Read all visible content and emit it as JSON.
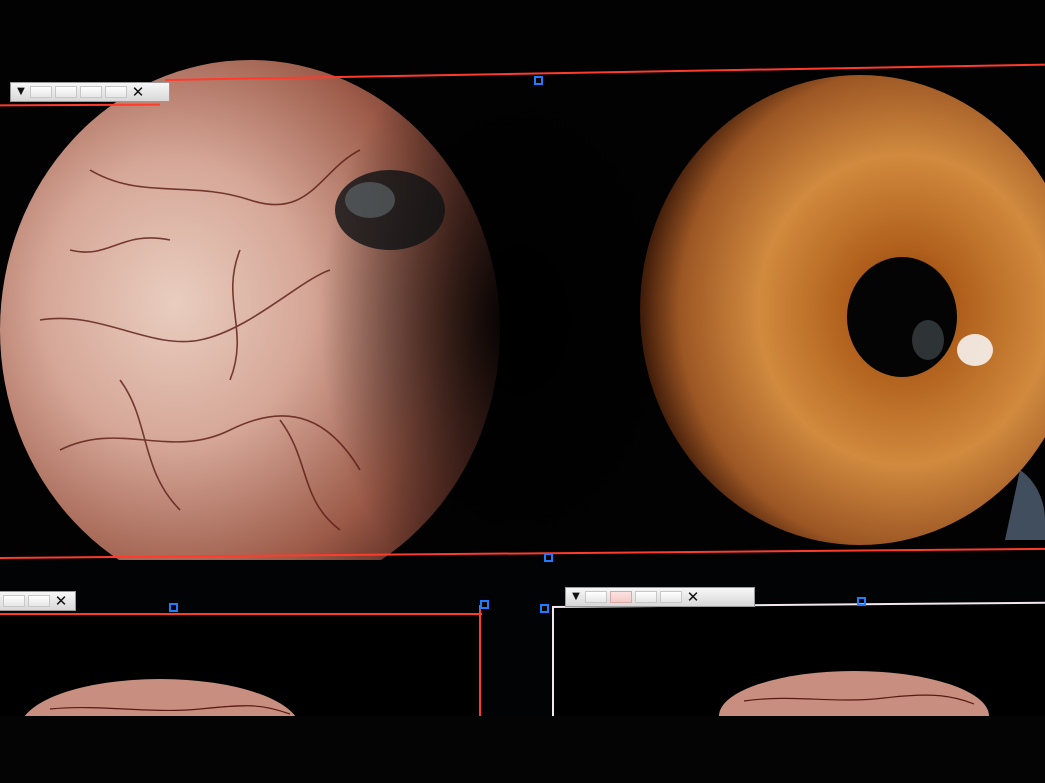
{
  "panels": {
    "main": {
      "toolbar": {
        "dropdown_glyph": "▼",
        "close_glyph": "✕",
        "slot_count": 4,
        "active_slot": -1
      }
    },
    "bottom_left": {
      "toolbar": {
        "close_glyph": "✕",
        "slot_count": 2,
        "active_slot": -1
      }
    },
    "bottom_right": {
      "toolbar": {
        "dropdown_glyph": "▼",
        "close_glyph": "✕",
        "slot_count": 5,
        "active_slot": 1
      }
    }
  },
  "colors": {
    "frame_selected": "#ff3b2c",
    "frame_unselected": "#f1e9ef",
    "handle": "#1f7bff",
    "iris": "#b86a2a",
    "sclera": "#c79c8f"
  },
  "icons": {
    "dropdown": "triangle-down-icon",
    "close": "close-icon",
    "handle": "resize-handle-icon"
  }
}
